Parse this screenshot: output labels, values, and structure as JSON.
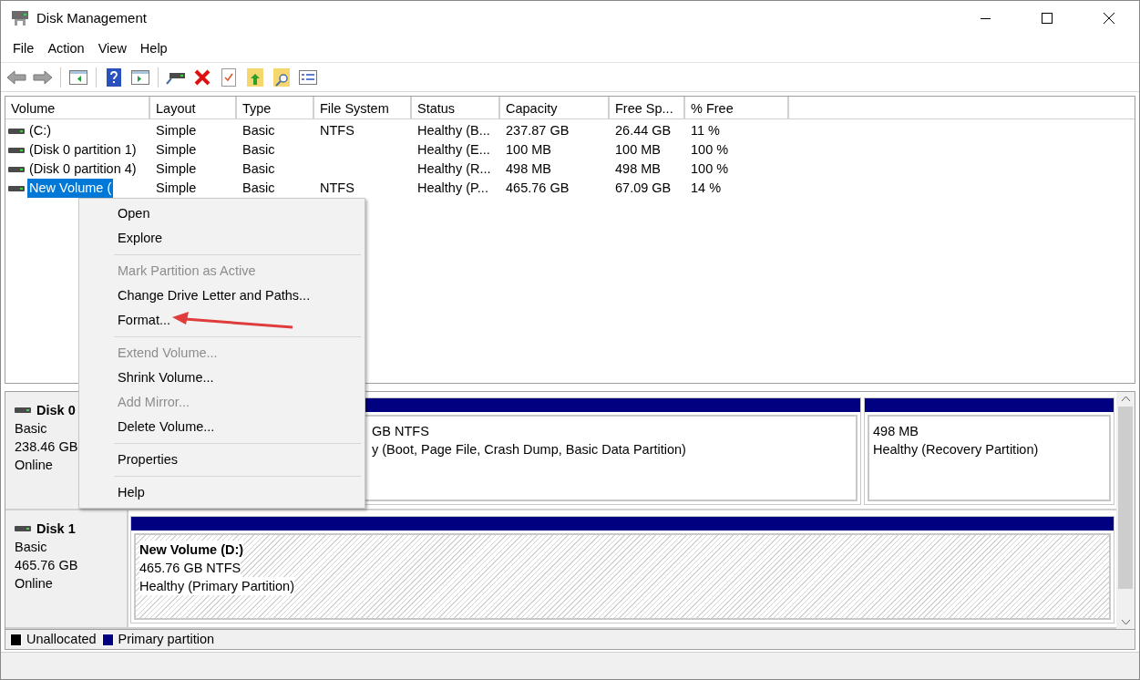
{
  "window": {
    "title": "Disk Management"
  },
  "menu_bar": [
    "File",
    "Action",
    "View",
    "Help"
  ],
  "table": {
    "columns": [
      "Volume",
      "Layout",
      "Type",
      "File System",
      "Status",
      "Capacity",
      "Free Sp...",
      "% Free"
    ],
    "rows": [
      {
        "selected": false,
        "cells": [
          "(C:)",
          "Simple",
          "Basic",
          "NTFS",
          "Healthy (B...",
          "237.87 GB",
          "26.44 GB",
          "11 %"
        ]
      },
      {
        "selected": false,
        "cells": [
          "(Disk 0 partition 1)",
          "Simple",
          "Basic",
          "",
          "Healthy (E...",
          "100 MB",
          "100 MB",
          "100 %"
        ]
      },
      {
        "selected": false,
        "cells": [
          "(Disk 0 partition 4)",
          "Simple",
          "Basic",
          "",
          "Healthy (R...",
          "498 MB",
          "498 MB",
          "100 %"
        ]
      },
      {
        "selected": true,
        "cells": [
          "New Volume (",
          "Simple",
          "Basic",
          "NTFS",
          "Healthy (P...",
          "465.76 GB",
          "67.09 GB",
          "14 %"
        ]
      }
    ]
  },
  "disks": [
    {
      "name": "Disk 0",
      "type": "Basic",
      "size": "238.46 GB",
      "status": "Online",
      "partitions": [
        {
          "selected": false,
          "lines": [
            "GB NTFS",
            "y (Boot, Page File, Crash Dump, Basic Data Partition)"
          ]
        },
        {
          "selected": false,
          "lines": [
            "498 MB",
            "Healthy (Recovery Partition)"
          ]
        }
      ]
    },
    {
      "name": "Disk 1",
      "type": "Basic",
      "size": "465.76 GB",
      "status": "Online",
      "partitions": [
        {
          "selected": true,
          "title": "New Volume  (D:)",
          "lines": [
            "465.76 GB NTFS",
            "Healthy (Primary Partition)"
          ]
        }
      ]
    }
  ],
  "legend": [
    {
      "label": "Unallocated",
      "color": "#000000"
    },
    {
      "label": "Primary partition",
      "color": "#000080"
    }
  ],
  "context_menu": {
    "items": [
      {
        "kind": "item",
        "label": "Open",
        "disabled": false
      },
      {
        "kind": "item",
        "label": "Explore",
        "disabled": false
      },
      {
        "kind": "separator"
      },
      {
        "kind": "item",
        "label": "Mark Partition as Active",
        "disabled": true
      },
      {
        "kind": "item",
        "label": "Change Drive Letter and Paths...",
        "disabled": false
      },
      {
        "kind": "item",
        "label": "Format...",
        "disabled": false
      },
      {
        "kind": "separator"
      },
      {
        "kind": "item",
        "label": "Extend Volume...",
        "disabled": true
      },
      {
        "kind": "item",
        "label": "Shrink Volume...",
        "disabled": false
      },
      {
        "kind": "item",
        "label": "Add Mirror...",
        "disabled": true
      },
      {
        "kind": "item",
        "label": "Delete Volume...",
        "disabled": false
      },
      {
        "kind": "separator"
      },
      {
        "kind": "item",
        "label": "Properties",
        "disabled": false
      },
      {
        "kind": "separator"
      },
      {
        "kind": "item",
        "label": "Help",
        "disabled": false
      }
    ]
  }
}
